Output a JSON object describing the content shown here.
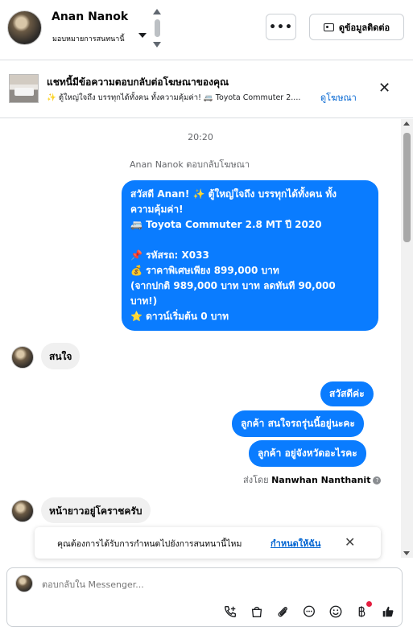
{
  "header": {
    "name": "Anan Nanok",
    "assign_label": "มอบหมายการสนทนานี้",
    "contact_button": "ดูข้อมูลติดต่อ"
  },
  "ad": {
    "title": "แชทนี้มีข้อความตอบกลับต่อโฆษณาของคุณ",
    "subtitle": "✨ ตู้ใหญ่ใจถึง บรรทุกได้ทั้งคน ทั้งความคุ้มค่า! 🚐 Toyota Commuter 2....",
    "view_ad": "ดูโฆษณา"
  },
  "chat": {
    "time": "20:20",
    "reply_note": "Anan Nanok ตอบกลับโฆษณา",
    "ad_message_lines": [
      "สวัสดี Anan! ✨ ตู้ใหญ่ใจถึง บรรทุกได้ทั้งคน ทั้ง",
      "ความคุ้มค่า!",
      "🚐 Toyota Commuter 2.8 MT ปี 2020",
      "",
      "📌 รหัสรถ: X033",
      "💰 ราคาพิเศษเพียง 899,000 บาท",
      "(จากปกติ 989,000 บาท บาท ลดทันที 90,000",
      "บาท!)",
      "⭐ ดาวน์เริ่มต้น 0 บาท"
    ],
    "msg_in_1": "สนใจ",
    "msg_out_1": "สวัสดีค่ะ",
    "msg_out_2": "ลูกค้า  สนใจรถรุ่นนี้อยู่นะคะ",
    "msg_out_3": "ลูกค้า อยู่จังหวัดอะไรคะ",
    "sent_by_prefix": "ส่งโดย",
    "sent_by_name": "Nanwhan Nanthanit",
    "msg_in_2": "หน้ายาวอยู่โคราชครับ"
  },
  "assign_prompt": {
    "text": "คุณต้องการได้รับการกำหนดไปยังการสนทนานี้ไหม",
    "link": "กำหนดให้ฉัน"
  },
  "composer": {
    "placeholder": "ตอบกลับใน Messenger..."
  },
  "icons": [
    "more-icon",
    "contact-card-icon",
    "close-icon",
    "add-call-icon",
    "shopping-bag-icon",
    "attachment-icon",
    "chat-bubble-icon",
    "emoji-icon",
    "payment-icon",
    "thumbs-up-icon"
  ],
  "colors": {
    "accent": "#0a7cff",
    "link": "#0064d1",
    "incoming_bubble": "#f0f0f0"
  }
}
